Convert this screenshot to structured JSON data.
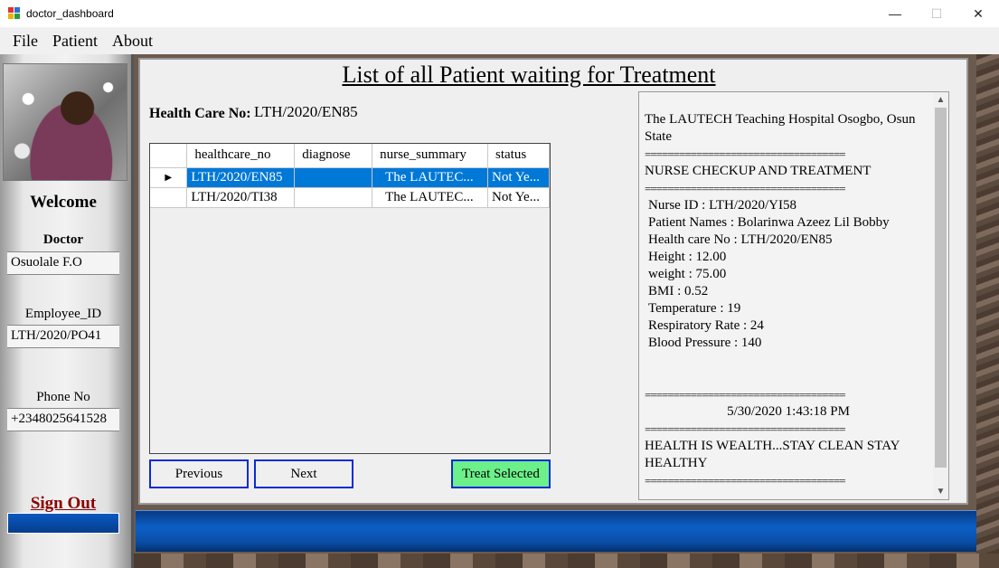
{
  "window": {
    "title": "doctor_dashboard",
    "controls": {
      "minimize": "—",
      "maximize": "☐",
      "close": "✕"
    }
  },
  "menu": [
    "File",
    "Patient",
    "About"
  ],
  "sidebar": {
    "welcome": "Welcome",
    "doctor_label": "Doctor",
    "doctor_name": "Osuolale F.O",
    "employee_label": "Employee_ID",
    "employee_id": "LTH/2020/PO41",
    "phone_label": "Phone No",
    "phone": "+2348025641528",
    "sign_out": "Sign Out"
  },
  "main": {
    "title": "List of all Patient waiting for Treatment",
    "hc_label": "Health Care No:",
    "hc_value": "LTH/2020/EN85"
  },
  "grid": {
    "columns": [
      "healthcare_no",
      "diagnose",
      "nurse_summary",
      "status"
    ],
    "rows": [
      {
        "healthcare_no": "LTH/2020/EN85",
        "diagnose": "",
        "nurse_summary": "The LAUTEC...",
        "status": "Not Ye..."
      },
      {
        "healthcare_no": "LTH/2020/TI38",
        "diagnose": "",
        "nurse_summary": "The LAUTEC...",
        "status": "Not Ye..."
      }
    ],
    "row_indicator": "▶"
  },
  "buttons": {
    "previous": "Previous",
    "next": "Next",
    "treat": "Treat Selected"
  },
  "receipt": {
    "hospital": "The LAUTECH Teaching Hospital Osogbo, Osun State",
    "separator": "===================================",
    "heading": "NURSE CHECKUP AND TREATMENT",
    "nurse_id": "Nurse ID : LTH/2020/YI58",
    "patient": "Patient Names : Bolarinwa Azeez Lil Bobby",
    "hc_no": "Health care No : LTH/2020/EN85",
    "height": "Height : 12.00",
    "weight": "weight : 75.00",
    "bmi": "BMI : 0.52",
    "temperature": "Temperature : 19",
    "respiratory": "Respiratory Rate : 24",
    "blood_pressure": "Blood Pressure : 140",
    "datetime": "5/30/2020  1:43:18 PM",
    "footer": "HEALTH IS WEALTH...STAY CLEAN STAY HEALTHY"
  },
  "colors": {
    "accent_blue": "#0078d7",
    "button_border": "#0a2bd6",
    "treat_button": "#6cf08a",
    "sign_out": "#8b0000"
  }
}
